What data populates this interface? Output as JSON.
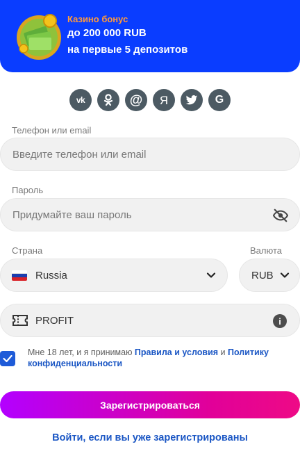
{
  "banner": {
    "bonus_title": "Казино бонус",
    "line1": "до 200 000 RUB",
    "line2": "на первые 5 депозитов",
    "bg_color": "#0a3dff",
    "accent_color": "#ff9a3c"
  },
  "social": [
    {
      "name": "vk-icon",
      "glyph": "vk"
    },
    {
      "name": "odnoklassniki-icon",
      "glyph": "ok"
    },
    {
      "name": "mailru-icon",
      "glyph": "@"
    },
    {
      "name": "yandex-icon",
      "glyph": "Я"
    },
    {
      "name": "twitter-icon",
      "glyph": "twitter"
    },
    {
      "name": "google-icon",
      "glyph": "G"
    }
  ],
  "form": {
    "phone_label": "Телефон или email",
    "phone_placeholder": "Введите телефон или email",
    "password_label": "Пароль",
    "password_placeholder": "Придумайте ваш пароль",
    "country_label": "Страна",
    "country_value": "Russia",
    "currency_label": "Валюта",
    "currency_value": "RUB",
    "promo_value": "PROFIT"
  },
  "terms": {
    "prefix": "Мне 18 лет, и я принимаю ",
    "rules_link": "Правила и условия",
    "middle": " и ",
    "privacy_link": "Политику конфиденциальности",
    "checked": true
  },
  "actions": {
    "register_button": "Зарегистрироваться",
    "login_link": "Войти, если вы уже зарегистрированы"
  }
}
